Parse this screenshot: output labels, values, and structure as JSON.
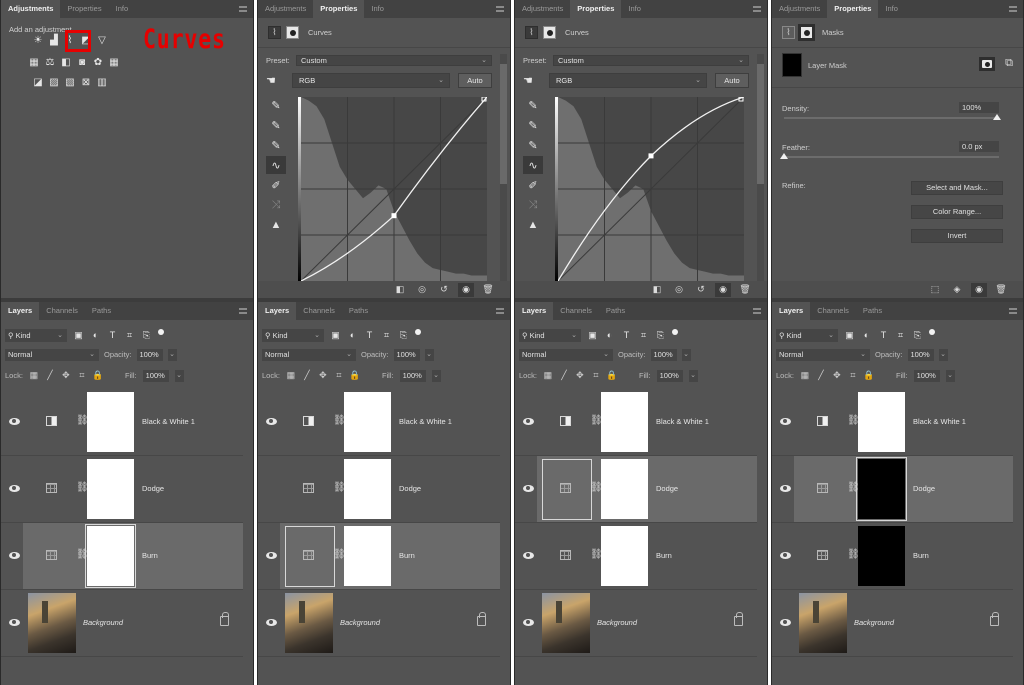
{
  "panels": [
    {
      "top_tabs": [
        "Adjustments",
        "Properties",
        "Info"
      ],
      "active_top_tab": 0,
      "adjustments": {
        "title": "Add an adjustment",
        "annotation": "Curves",
        "highlight_color": "#e60000",
        "rows": [
          [
            "brightness-contrast-icon",
            "levels-icon",
            "curves-icon",
            "exposure-icon",
            "vibrance-icon"
          ],
          [
            "hue-saturation-icon",
            "color-balance-icon",
            "black-white-icon",
            "photo-filter-icon",
            "channel-mixer-icon",
            "color-lookup-icon"
          ],
          [
            "invert-icon",
            "posterize-icon",
            "threshold-icon",
            "selective-color-icon",
            "gradient-map-icon"
          ]
        ]
      },
      "layers_header": {
        "tabs": [
          "Layers",
          "Channels",
          "Paths"
        ],
        "kind": "Kind",
        "blend": "Normal",
        "opacity_label": "Opacity:",
        "opacity": "100%",
        "lock_label": "Lock:",
        "fill_label": "Fill:",
        "fill": "100%"
      },
      "layers": [
        {
          "name": "Black & White 1",
          "type": "bw",
          "mask": "white",
          "visible": true,
          "selected": false
        },
        {
          "name": "Dodge",
          "type": "curves",
          "mask": "white",
          "visible": true,
          "selected": false
        },
        {
          "name": "Burn",
          "type": "curves",
          "mask": "white",
          "visible": true,
          "selected": true,
          "mask_framed": true
        },
        {
          "name": "Background",
          "type": "photo",
          "visible": true,
          "selected": false,
          "locked": true
        }
      ]
    },
    {
      "top_tabs": [
        "Adjustments",
        "Properties",
        "Info"
      ],
      "active_top_tab": 1,
      "properties": {
        "type_label": "Curves",
        "preset_label": "Preset:",
        "preset": "Custom",
        "channel": "RGB",
        "auto_label": "Auto",
        "curve_point": {
          "input": 0.5,
          "output": 0.355
        }
      },
      "layers_header": {
        "tabs": [
          "Layers",
          "Channels",
          "Paths"
        ],
        "kind": "Kind",
        "blend": "Normal",
        "opacity_label": "Opacity:",
        "opacity": "100%",
        "lock_label": "Lock:",
        "fill_label": "Fill:",
        "fill": "100%"
      },
      "layers": [
        {
          "name": "Black & White 1",
          "type": "bw",
          "mask": "white",
          "visible": true,
          "selected": false
        },
        {
          "name": "Dodge",
          "type": "curves",
          "mask": "white",
          "visible": false,
          "selected": false
        },
        {
          "name": "Burn",
          "type": "curves",
          "mask": "white",
          "visible": true,
          "selected": true,
          "adj_framed": true
        },
        {
          "name": "Background",
          "type": "photo",
          "visible": true,
          "selected": false,
          "locked": true
        }
      ]
    },
    {
      "top_tabs": [
        "Adjustments",
        "Properties",
        "Info"
      ],
      "active_top_tab": 1,
      "properties": {
        "type_label": "Curves",
        "preset_label": "Preset:",
        "preset": "Custom",
        "channel": "RGB",
        "auto_label": "Auto",
        "curve_point": {
          "input": 0.5,
          "output": 0.68
        }
      },
      "layers_header": {
        "tabs": [
          "Layers",
          "Channels",
          "Paths"
        ],
        "kind": "Kind",
        "blend": "Normal",
        "opacity_label": "Opacity:",
        "opacity": "100%",
        "lock_label": "Lock:",
        "fill_label": "Fill:",
        "fill": "100%"
      },
      "layers": [
        {
          "name": "Black & White 1",
          "type": "bw",
          "mask": "white",
          "visible": true,
          "selected": false
        },
        {
          "name": "Dodge",
          "type": "curves",
          "mask": "white",
          "visible": true,
          "selected": true,
          "adj_framed": true
        },
        {
          "name": "Burn",
          "type": "curves",
          "mask": "white",
          "visible": true,
          "selected": false
        },
        {
          "name": "Background",
          "type": "photo",
          "visible": true,
          "selected": false,
          "locked": true
        }
      ]
    },
    {
      "top_tabs": [
        "Adjustments",
        "Properties",
        "Info"
      ],
      "active_top_tab": 1,
      "masks": {
        "type_label": "Masks",
        "layer_mask_label": "Layer Mask",
        "density_label": "Density:",
        "density": "100%",
        "density_value": 1.0,
        "feather_label": "Feather:",
        "feather": "0.0 px",
        "feather_value": 0.0,
        "refine_label": "Refine:",
        "buttons": [
          "Select and Mask...",
          "Color Range...",
          "Invert"
        ]
      },
      "layers_header": {
        "tabs": [
          "Layers",
          "Channels",
          "Paths"
        ],
        "kind": "Kind",
        "blend": "Normal",
        "opacity_label": "Opacity:",
        "opacity": "100%",
        "lock_label": "Lock:",
        "fill_label": "Fill:",
        "fill": "100%"
      },
      "layers": [
        {
          "name": "Black & White 1",
          "type": "bw",
          "mask": "white",
          "visible": true,
          "selected": false
        },
        {
          "name": "Dodge",
          "type": "curves",
          "mask": "black",
          "visible": true,
          "selected": true,
          "mask_framed": true
        },
        {
          "name": "Burn",
          "type": "curves",
          "mask": "black",
          "visible": true,
          "selected": false
        },
        {
          "name": "Background",
          "type": "photo",
          "visible": true,
          "selected": false,
          "locked": true
        }
      ]
    }
  ]
}
